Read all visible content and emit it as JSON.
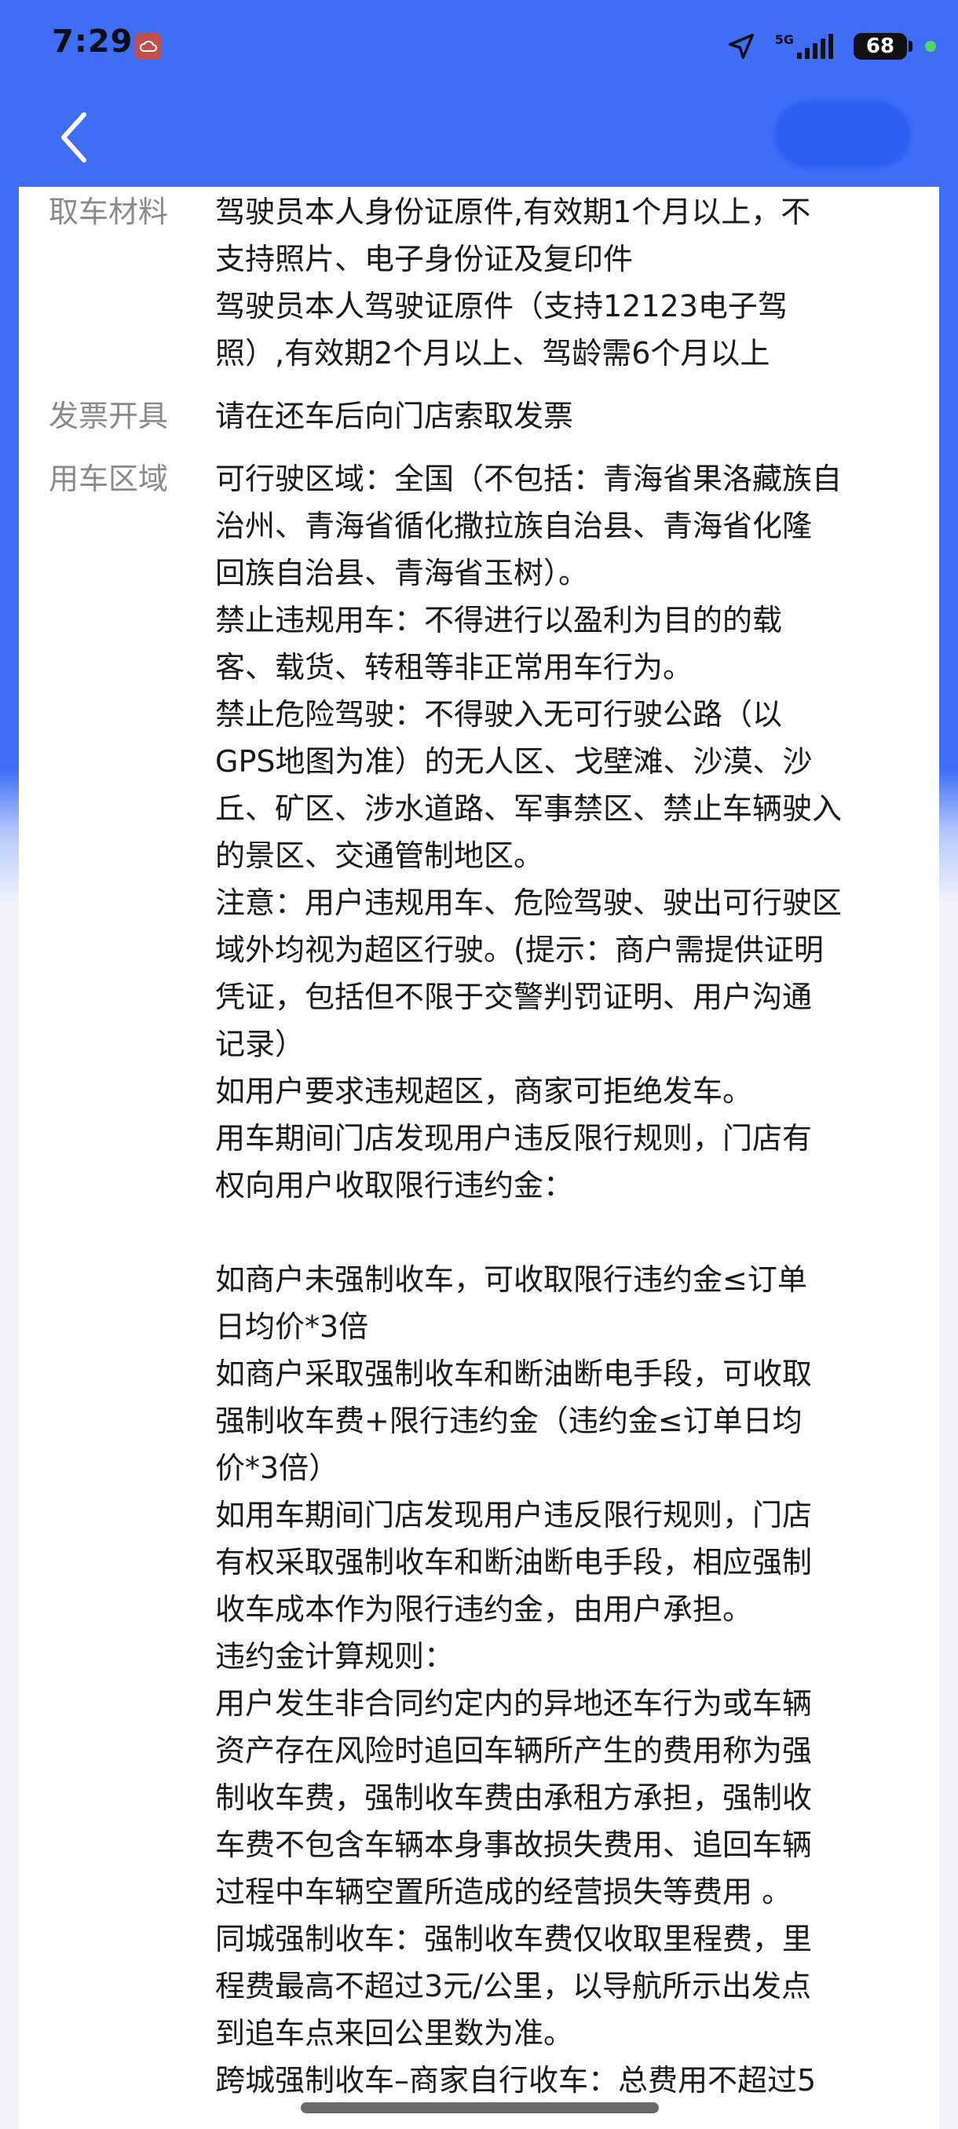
{
  "status_bar": {
    "time": "7:29",
    "network": "5G",
    "battery": "68"
  },
  "colors": {
    "header_blue": "#3f6df6",
    "accent_green": "#4cd964",
    "label_gray": "#8a8a8a",
    "text_dark": "#1a1a1a"
  },
  "icons": {
    "back": "back-chevron-icon",
    "location": "location-arrow-icon",
    "cloud": "cloud-icon",
    "signal": "signal-bars-icon",
    "battery": "battery-icon"
  },
  "sections": [
    {
      "label": "取车材料",
      "lines": [
        "驾驶员本人身份证原件,有效期1个月以上，不",
        "支持照片、电子身份证及复印件",
        "驾驶员本人驾驶证原件（支持12123电子驾",
        "照）,有效期2个月以上、驾龄需6个月以上"
      ]
    },
    {
      "label": "发票开具",
      "lines": [
        "请在还车后向门店索取发票"
      ]
    },
    {
      "label": "用车区域",
      "lines": [
        "可行驶区域：全国（不包括：青海省果洛藏族自",
        "治州、青海省循化撒拉族自治县、青海省化隆",
        "回族自治县、青海省玉树）。",
        "禁止违规用车：不得进行以盈利为目的的载",
        "客、载货、转租等非正常用车行为。",
        "禁止危险驾驶：不得驶入无可行驶公路（以",
        "GPS地图为准）的无人区、戈壁滩、沙漠、沙",
        "丘、矿区、涉水道路、军事禁区、禁止车辆驶入",
        "的景区、交通管制地区。",
        "注意：用户违规用车、危险驾驶、驶出可行驶区",
        "域外均视为超区行驶。(提示：商户需提供证明",
        "凭证，包括但不限于交警判罚证明、用户沟通",
        "记录）",
        "如用户要求违规超区，商家可拒绝发车。",
        "用车期间门店发现用户违反限行规则，门店有",
        "权向用户收取限行违约金：",
        "",
        "如商户未强制收车，可收取限行违约金≤订单",
        "日均价*3倍",
        "如商户采取强制收车和断油断电手段，可收取",
        "强制收车费+限行违约金（违约金≤订单日均",
        "价*3倍）",
        "如用车期间门店发现用户违反限行规则，门店",
        "有权采取强制收车和断油断电手段，相应强制",
        "收车成本作为限行违约金，由用户承担。",
        "违约金计算规则：",
        "用户发生非合同约定内的异地还车行为或车辆",
        "资产存在风险时追回车辆所产生的费用称为强",
        "制收车费，强制收车费由承租方承担，强制收",
        "车费不包含车辆本身事故损失费用、追回车辆",
        "过程中车辆空置所造成的经营损失等费用 。",
        "同城强制收车：强制收车费仅收取里程费，里",
        "程费最高不超过3元/公里，以导航所示出发点",
        "到追车点来回公里数为准。",
        "跨城强制收车–商家自行收车：总费用不超过5"
      ]
    }
  ]
}
